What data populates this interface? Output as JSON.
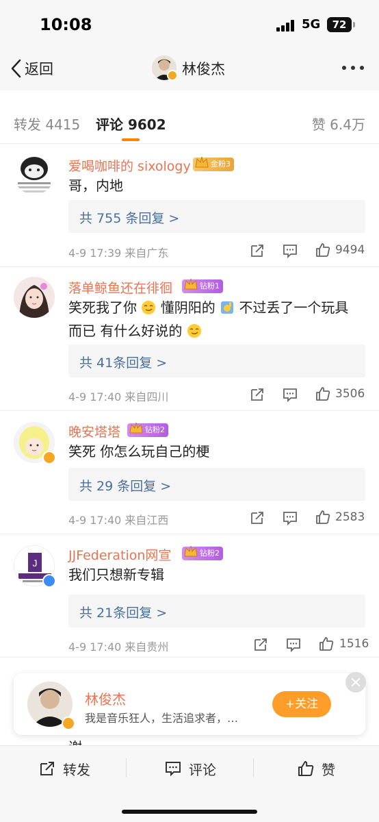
{
  "status_bar": {
    "time": "10:08",
    "network": "5G",
    "battery": "72"
  },
  "nav": {
    "back_label": "返回",
    "title": "林俊杰"
  },
  "tabs": {
    "repost": "转发 4415",
    "comment": "评论 9602",
    "like": "赞 6.4万"
  },
  "comments": [
    {
      "name": "爱喝咖啡的 sixology",
      "badge": "金粉3",
      "text": "哥，内地",
      "reply_label": "共 755 条回复 >",
      "meta": "4-9 17:39  来自广东",
      "likes": "9494"
    },
    {
      "name": "落单鲸鱼还在徘徊",
      "badge": "钻粉1",
      "text_parts": [
        "笑死我了你",
        "懂阴阳的",
        "不过丢了一个玩具而已 有什么好说的"
      ],
      "reply_label": "共 41条回复 >",
      "meta": "4-9 17:40  来自四川",
      "likes": "3506"
    },
    {
      "name": "晚安塔塔",
      "badge": "钻粉2",
      "text": "笑死 你怎么玩自己的梗",
      "reply_label": "共 29 条回复 >",
      "meta": "4-9 17:40  来自江西",
      "likes": "2583"
    },
    {
      "name": "JJFederation网宣",
      "badge": "钻粉2",
      "text": "我们只想新专辑",
      "reply_label": "共 21条回复 >",
      "meta": "4-9 17:40  来自贵州",
      "likes": "1516"
    }
  ],
  "popup": {
    "name": "林俊杰",
    "bio": "我是音乐狂人，生活追求者，…",
    "follow_label": "+关注"
  },
  "partial_text": "谢",
  "bottom_bar": {
    "repost": "转发",
    "comment": "评论",
    "like": "赞"
  },
  "colors": {
    "accent": "#ff8200",
    "username": "#eb7350",
    "reply_link": "#4a6f9c",
    "follow": "#ff9d2a",
    "verified": "#f5a623",
    "verified_blue": "#3d8bf5"
  }
}
